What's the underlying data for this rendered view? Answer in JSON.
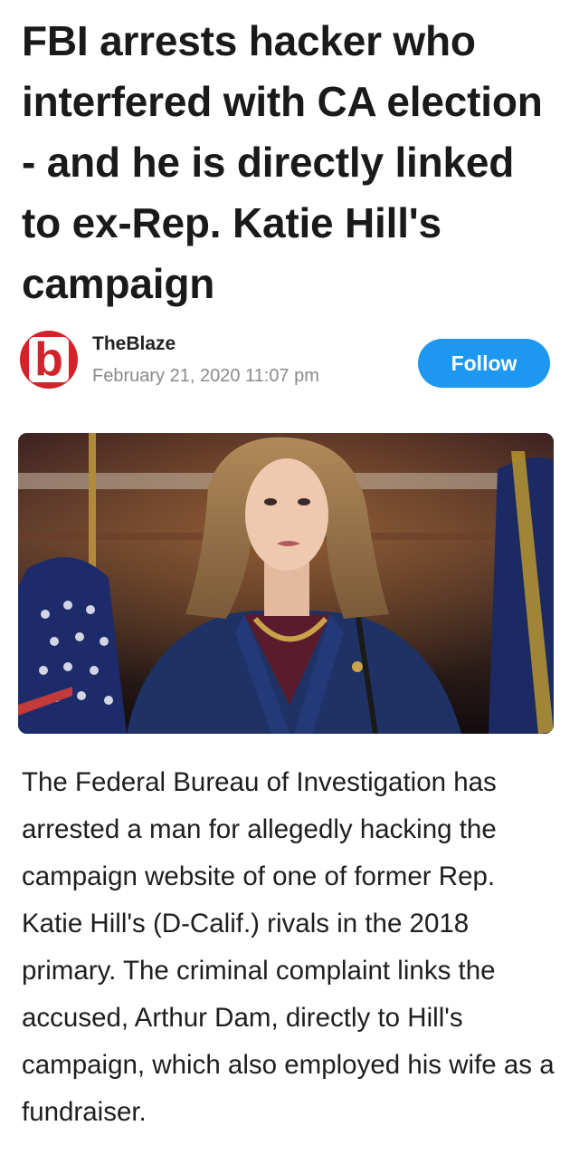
{
  "article": {
    "headline": "FBI arrests hacker who interfered with CA election - and he is directly linked to ex-Rep. Katie Hill's campaign",
    "body": "The Federal Bureau of Investigation has arrested a man for allegedly hacking the campaign website of one of former Rep. Katie Hill's (D-Calif.) rivals in the 2018 primary. The criminal complaint links the accused, Arthur Dam, directly to Hill's campaign, which also employed his wife as a fundraiser."
  },
  "author": {
    "name": "TheBlaze",
    "date": "February 21, 2020 11:07 pm",
    "avatar_letter": "b",
    "avatar_icon": "theblaze-logo-icon",
    "brand_color": "#d2232a"
  },
  "follow_button": {
    "label": "Follow",
    "color": "#1d97f0"
  },
  "photo": {
    "subject": "press-photo"
  }
}
